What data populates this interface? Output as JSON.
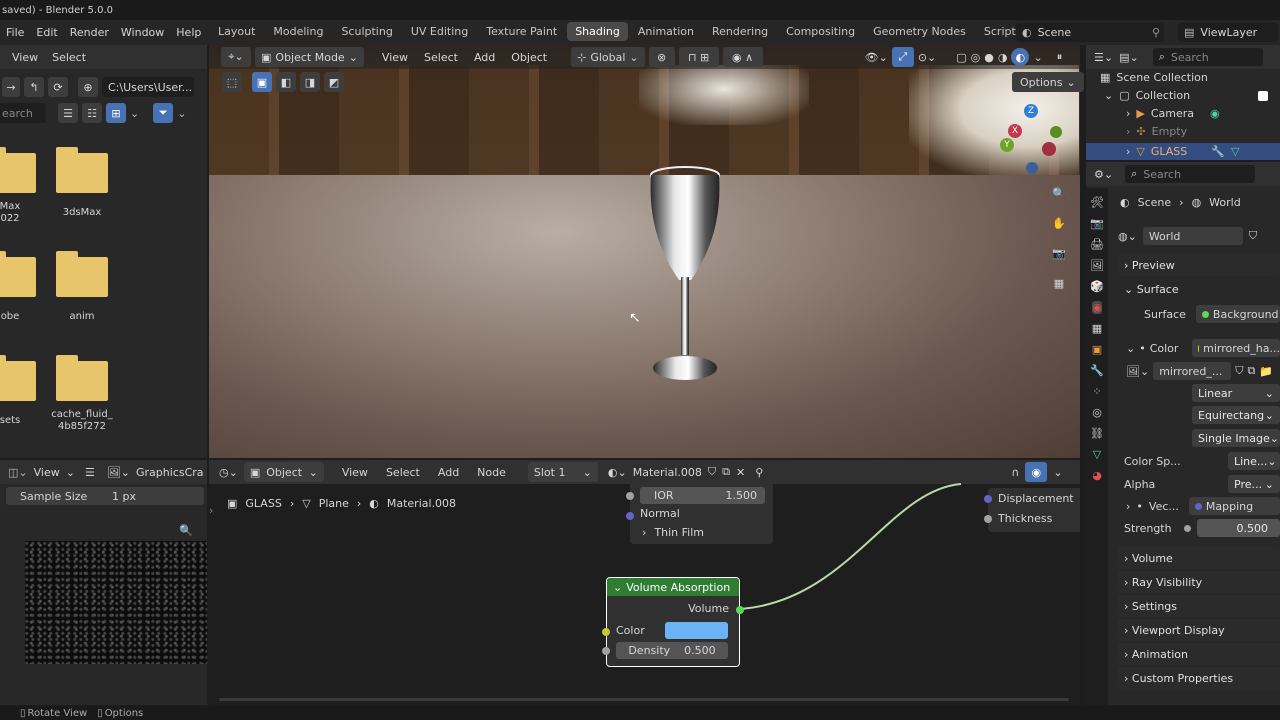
{
  "title_bar": {
    "text": "saved) - Blender 5.0.0"
  },
  "menu": [
    "File",
    "Edit",
    "Render",
    "Window",
    "Help"
  ],
  "workspaces": [
    "Layout",
    "Modeling",
    "Sculpting",
    "UV Editing",
    "Texture Paint",
    "Shading",
    "Animation",
    "Rendering",
    "Compositing",
    "Geometry Nodes",
    "Scripting"
  ],
  "active_workspace": "Shading",
  "plus_glyph": "+",
  "scene": {
    "label": "Scene"
  },
  "view_layer": {
    "label": "ViewLayer"
  },
  "file_browser": {
    "view": "View",
    "select": "Select",
    "path": "C:\\Users\\User...",
    "search_placeholder": "earch",
    "folders": [
      {
        "name": "Max\n022"
      },
      {
        "name": "3dsMax"
      },
      {
        "name": "obe"
      },
      {
        "name": "anim"
      },
      {
        "name": "sets"
      },
      {
        "name": "cache_fluid_\n4b85f272"
      }
    ]
  },
  "viewport": {
    "mode": "Object Mode",
    "view": "View",
    "select": "Select",
    "add": "Add",
    "object": "Object",
    "orientation": "Global",
    "options": "Options",
    "gizmo_x": "X",
    "gizmo_y": "Y",
    "gizmo_z": "Z"
  },
  "image_editor": {
    "view": "View",
    "name": "GraphicsCra",
    "sample_size_label": "Sample Size",
    "sample_size_value": "1 px"
  },
  "node_editor": {
    "object": "Object",
    "view": "View",
    "select": "Select",
    "add": "Add",
    "node": "Node",
    "slot": "Slot 1",
    "material": "Material.008",
    "breadcrumb": [
      "GLASS",
      "Plane",
      "Material.008"
    ],
    "bsdf": {
      "ior_label": "IOR",
      "ior_value": "1.500",
      "normal": "Normal",
      "thin_film": "Thin Film"
    },
    "output": {
      "displacement": "Displacement",
      "thickness": "Thickness"
    },
    "volume_absorption": {
      "title": "Volume Absorption",
      "volume": "Volume",
      "color_label": "Color",
      "color_value": "#6bb3f5",
      "density_label": "Density",
      "density_value": "0.500"
    }
  },
  "outliner": {
    "search_placeholder": "Search",
    "scene_collection": "Scene Collection",
    "items": [
      {
        "label": "Collection"
      },
      {
        "label": "Camera"
      },
      {
        "label": "Empty"
      },
      {
        "label": "GLASS"
      }
    ]
  },
  "properties": {
    "search_placeholder": "Search",
    "breadcrumb": [
      "Scene",
      "World"
    ],
    "world_name": "World",
    "panels": {
      "preview": "Preview",
      "surface": "Surface",
      "volume": "Volume",
      "ray_visibility": "Ray Visibility",
      "settings": "Settings",
      "viewport_display": "Viewport Display",
      "animation": "Animation",
      "custom_properties": "Custom Properties"
    },
    "surface_label": "Surface",
    "surface_value": "Background",
    "color_label": "Color",
    "color_value": "mirrored_ha...",
    "image_name": "mirrored_...",
    "interpolation": "Linear",
    "projection": "Equirectang...",
    "source": "Single Image",
    "alpha_label": "Alpha",
    "alpha_value": "Pre...",
    "color_space_label": "Color Sp...",
    "color_space_value": "Line...",
    "vector_label": "Vec...",
    "vector_value": "Mapping",
    "strength_label": "Strength",
    "strength_value": "0.500"
  },
  "status_bar": {
    "rotate_view": "Rotate View",
    "options": "Options"
  }
}
